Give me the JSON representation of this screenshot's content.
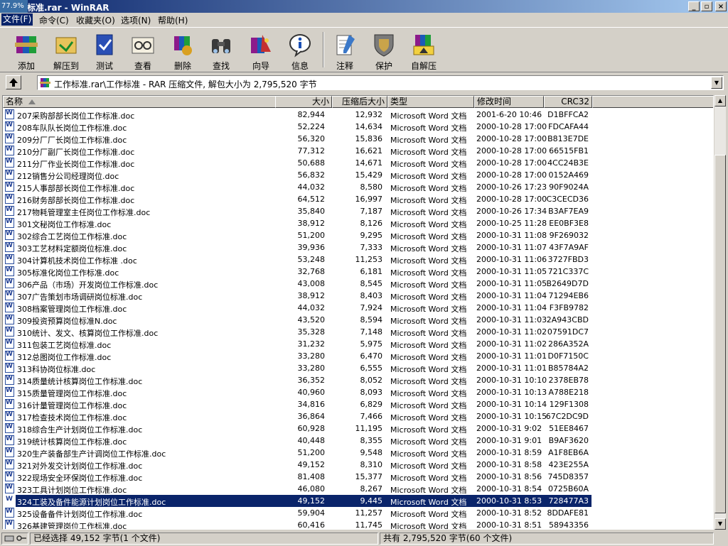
{
  "window": {
    "title": "工作标准.rar - WinRAR",
    "title_visible": "作标准.rar - WinRAR",
    "progress_overlay": "77.9%"
  },
  "menu": [
    {
      "label": "文件(F)"
    },
    {
      "label": "命令(C)"
    },
    {
      "label": "收藏夹(O)"
    },
    {
      "label": "选项(N)"
    },
    {
      "label": "帮助(H)"
    }
  ],
  "toolbar": [
    {
      "label": "添加",
      "icon": "add-icon"
    },
    {
      "label": "解压到",
      "icon": "extract-to-icon"
    },
    {
      "label": "测试",
      "icon": "test-icon"
    },
    {
      "label": "查看",
      "icon": "view-icon"
    },
    {
      "label": "删除",
      "icon": "delete-icon"
    },
    {
      "label": "查找",
      "icon": "find-icon"
    },
    {
      "label": "向导",
      "icon": "wizard-icon"
    },
    {
      "label": "信息",
      "icon": "info-icon"
    },
    {
      "label": "注释",
      "icon": "comment-icon"
    },
    {
      "label": "保护",
      "icon": "protect-icon"
    },
    {
      "label": "自解压",
      "icon": "sfx-icon"
    }
  ],
  "address": {
    "path": "工作标准.rar\\工作标准 - RAR 压缩文件, 解包大小为 2,795,520 字节"
  },
  "columns": {
    "name": "名称",
    "size": "大小",
    "packed": "压缩后大小",
    "type": "类型",
    "modified": "修改时间",
    "crc": "CRC32"
  },
  "files": [
    {
      "name": "207采购部部长岗位工作标准.doc",
      "size": "82,944",
      "packed": "12,932",
      "type": "Microsoft Word 文档",
      "modified": "2001-6-20 10:46",
      "crc": "D1BFFCA2"
    },
    {
      "name": "208车队队长岗位工作标准.doc",
      "size": "52,224",
      "packed": "14,634",
      "type": "Microsoft Word 文档",
      "modified": "2000-10-28 17:00",
      "crc": "FDCAFA44"
    },
    {
      "name": "209分厂厂长岗位工作标准.doc",
      "size": "56,320",
      "packed": "15,836",
      "type": "Microsoft Word 文档",
      "modified": "2000-10-28 17:00",
      "crc": "B813E7DE"
    },
    {
      "name": "210分厂副厂长岗位工作标准.doc",
      "size": "77,312",
      "packed": "16,621",
      "type": "Microsoft Word 文档",
      "modified": "2000-10-28 17:00",
      "crc": "66515FB1"
    },
    {
      "name": "211分厂作业长岗位工作标准.doc",
      "size": "50,688",
      "packed": "14,671",
      "type": "Microsoft Word 文档",
      "modified": "2000-10-28 17:00",
      "crc": "4CC24B3E"
    },
    {
      "name": "212销售分公司经理岗位.doc",
      "size": "56,832",
      "packed": "15,429",
      "type": "Microsoft Word 文档",
      "modified": "2000-10-28 17:00",
      "crc": "0152A469"
    },
    {
      "name": "215人事部部长岗位工作标准.doc",
      "size": "44,032",
      "packed": "8,580",
      "type": "Microsoft Word 文档",
      "modified": "2000-10-26 17:23",
      "crc": "90F9024A"
    },
    {
      "name": "216财务部部长岗位工作标准.doc",
      "size": "64,512",
      "packed": "16,997",
      "type": "Microsoft Word 文档",
      "modified": "2000-10-28 17:00",
      "crc": "C3CECD36"
    },
    {
      "name": "217物耗管理室主任岗位工作标准.doc",
      "size": "35,840",
      "packed": "7,187",
      "type": "Microsoft Word 文档",
      "modified": "2000-10-26 17:34",
      "crc": "B3AF7EA9"
    },
    {
      "name": "301文秘岗位工作标准.doc",
      "size": "38,912",
      "packed": "8,126",
      "type": "Microsoft Word 文档",
      "modified": "2000-10-25 11:28",
      "crc": "EE0BF3E8"
    },
    {
      "name": "302综合工艺岗位工作标准.doc",
      "size": "51,200",
      "packed": "9,295",
      "type": "Microsoft Word 文档",
      "modified": "2000-10-31 11:08",
      "crc": "9F269032"
    },
    {
      "name": "303工艺材料定额岗位标准.doc",
      "size": "39,936",
      "packed": "7,333",
      "type": "Microsoft Word 文档",
      "modified": "2000-10-31 11:07",
      "crc": "43F7A9AF"
    },
    {
      "name": "304计算机技术岗位工作标准 .doc",
      "size": "53,248",
      "packed": "11,253",
      "type": "Microsoft Word 文档",
      "modified": "2000-10-31 11:06",
      "crc": "3727FBD3"
    },
    {
      "name": "305标准化岗位工作标准.doc",
      "size": "32,768",
      "packed": "6,181",
      "type": "Microsoft Word 文档",
      "modified": "2000-10-31 11:05",
      "crc": "721C337C"
    },
    {
      "name": "306产品（市场）开发岗位工作标准.doc",
      "size": "43,008",
      "packed": "8,545",
      "type": "Microsoft Word 文档",
      "modified": "2000-10-31 11:05",
      "crc": "B2649D7D"
    },
    {
      "name": "307广告策划市场调研岗位标准.doc",
      "size": "38,912",
      "packed": "8,403",
      "type": "Microsoft Word 文档",
      "modified": "2000-10-31 11:04",
      "crc": "71294EB6"
    },
    {
      "name": "308档案管理岗位工作标准.doc",
      "size": "44,032",
      "packed": "7,924",
      "type": "Microsoft Word 文档",
      "modified": "2000-10-31 11:04",
      "crc": "F3FB9782"
    },
    {
      "name": "309投资预算岗位标准N.doc",
      "size": "43,520",
      "packed": "8,594",
      "type": "Microsoft Word 文档",
      "modified": "2000-10-31 11:03",
      "crc": "2A943CBD"
    },
    {
      "name": "310统计、发文、核算岗位工作标准.doc",
      "size": "35,328",
      "packed": "7,148",
      "type": "Microsoft Word 文档",
      "modified": "2000-10-31 11:02",
      "crc": "07591DC7"
    },
    {
      "name": "311包装工艺岗位标准.doc",
      "size": "31,232",
      "packed": "5,975",
      "type": "Microsoft Word 文档",
      "modified": "2000-10-31 11:02",
      "crc": "286A352A"
    },
    {
      "name": "312总图岗位工作标准.doc",
      "size": "33,280",
      "packed": "6,470",
      "type": "Microsoft Word 文档",
      "modified": "2000-10-31 11:01",
      "crc": "D0F7150C"
    },
    {
      "name": "313科协岗位标准.doc",
      "size": "33,280",
      "packed": "6,555",
      "type": "Microsoft Word 文档",
      "modified": "2000-10-31 11:01",
      "crc": "B85784A2"
    },
    {
      "name": "314质量统计核算岗位工作标准.doc",
      "size": "36,352",
      "packed": "8,052",
      "type": "Microsoft Word 文档",
      "modified": "2000-10-31 10:10",
      "crc": "2378EB78"
    },
    {
      "name": "315质量管理岗位工作标准.doc",
      "size": "40,960",
      "packed": "8,093",
      "type": "Microsoft Word 文档",
      "modified": "2000-10-31 10:13",
      "crc": "A788E218"
    },
    {
      "name": "316计量管理岗位工作标准.doc",
      "size": "34,816",
      "packed": "6,829",
      "type": "Microsoft Word 文档",
      "modified": "2000-10-31 10:14",
      "crc": "129F1308"
    },
    {
      "name": "317检查技术岗位工作标准.doc",
      "size": "36,864",
      "packed": "7,466",
      "type": "Microsoft Word 文档",
      "modified": "2000-10-31 10:15",
      "crc": "67C2DC9D"
    },
    {
      "name": "318综合生产计划岗位工作标准.doc",
      "size": "60,928",
      "packed": "11,195",
      "type": "Microsoft Word 文档",
      "modified": "2000-10-31 9:02",
      "crc": "51EE8467"
    },
    {
      "name": "319统计核算岗位工作标准.doc",
      "size": "40,448",
      "packed": "8,355",
      "type": "Microsoft Word 文档",
      "modified": "2000-10-31 9:01",
      "crc": "B9AF3620"
    },
    {
      "name": "320生产装备部生产计调岗位工作标准.doc",
      "size": "51,200",
      "packed": "9,548",
      "type": "Microsoft Word 文档",
      "modified": "2000-10-31 8:59",
      "crc": "A1F8EB6A"
    },
    {
      "name": "321对外发交计划岗位工作标准.doc",
      "size": "49,152",
      "packed": "8,310",
      "type": "Microsoft Word 文档",
      "modified": "2000-10-31 8:58",
      "crc": "423E255A"
    },
    {
      "name": "322现场安全环保岗位工作标准.doc",
      "size": "81,408",
      "packed": "15,377",
      "type": "Microsoft Word 文档",
      "modified": "2000-10-31 8:56",
      "crc": "745D8357"
    },
    {
      "name": "323工具计划岗位工作标准.doc",
      "size": "46,080",
      "packed": "8,267",
      "type": "Microsoft Word 文档",
      "modified": "2000-10-31 8:54",
      "crc": "0725B60A"
    },
    {
      "name": "324工装及备件能源计划岗位工作标准.doc",
      "size": "49,152",
      "packed": "9,445",
      "type": "Microsoft Word 文档",
      "modified": "2000-10-31 8:53",
      "crc": "728477A3",
      "selected": true
    },
    {
      "name": "325设备备件计划岗位工作标准.doc",
      "size": "59,904",
      "packed": "11,257",
      "type": "Microsoft Word 文档",
      "modified": "2000-10-31 8:52",
      "crc": "8DDAFE81"
    },
    {
      "name": "326基建管理岗位工作标准.doc",
      "size": "60,416",
      "packed": "11,745",
      "type": "Microsoft Word 文档",
      "modified": "2000-10-31 8:51",
      "crc": "58943356"
    }
  ],
  "status": {
    "selected": "已经选择 49,152 字节(1 个文件)",
    "total": "共有 2,795,520 字节(60 个文件)"
  }
}
